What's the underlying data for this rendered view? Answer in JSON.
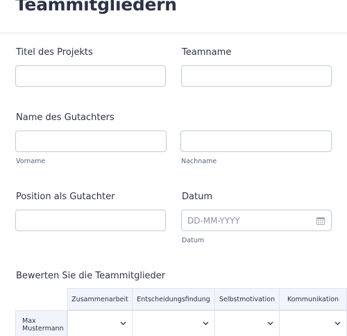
{
  "form": {
    "heading": "Teammitgliedern",
    "project_title_label": "Titel des Projekts",
    "team_name_label": "Teamname",
    "reviewer_name_label": "Name des Gutachters",
    "first_name_sublabel": "Vorname",
    "last_name_sublabel": "Nachname",
    "position_label": "Position als Gutachter",
    "date_label": "Datum",
    "date_placeholder": "DD-MM-YYYY",
    "date_sublabel": "Datum",
    "rating_label": "Bewerten Sie die Teammitglieder"
  },
  "matrix": {
    "columns": [
      "Zusammenarbeit",
      "Entscheidungsfindung",
      "Selbstmotivation",
      "Kommunikation"
    ],
    "rows": [
      {
        "name_line1": "Max",
        "name_line2": "Mustermann"
      }
    ]
  },
  "icons": {
    "calendar": "calendar-icon",
    "dropdown": "chevron-down-icon"
  },
  "colors": {
    "text": "#2c3345",
    "border": "#c3cad8",
    "header_bg": "#f1f4fb"
  }
}
